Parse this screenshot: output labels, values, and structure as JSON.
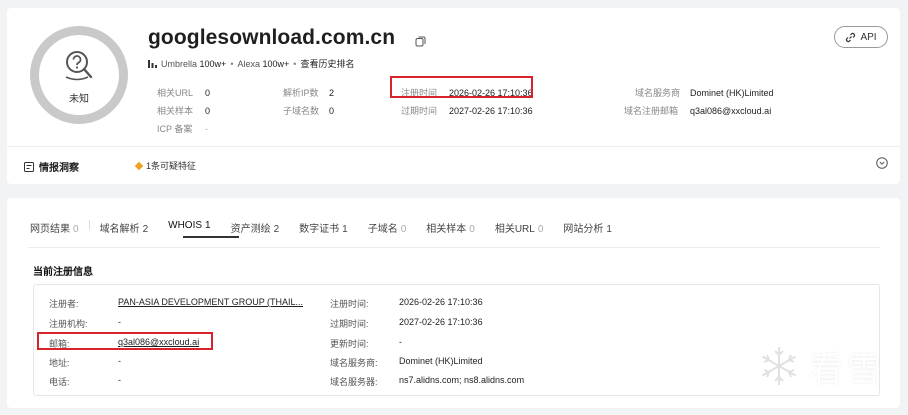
{
  "header": {
    "domain": "googlesownload.com.cn",
    "risk_label": "未知",
    "api_label": "API",
    "rank": {
      "umbrella_label": "Umbrella",
      "umbrella_value": "100w+",
      "alexa_label": "Alexa",
      "alexa_value": "100w+",
      "history_link": "查看历史排名"
    },
    "meta": {
      "related_url_label": "相关URL",
      "related_url_value": "0",
      "dns_ip_label": "解析IP数",
      "dns_ip_value": "2",
      "reg_time_label": "注册时间",
      "reg_time_value": "2026-02-26 17:10:36",
      "registrar_label": "域名服务商",
      "registrar_value": "Dominet (HK)Limited",
      "related_sample_label": "相关样本",
      "related_sample_value": "0",
      "subdomain_label": "子域名数",
      "subdomain_value": "0",
      "expire_label": "过期时间",
      "expire_value": "2027-02-26 17:10:36",
      "reg_email_label": "域名注册邮箱",
      "reg_email_value": "q3al086@xxcloud.ai",
      "icp_label": "ICP 备案",
      "icp_value": "-"
    },
    "intel": {
      "title": "情报洞察",
      "suspicious": "1条可疑特征"
    }
  },
  "tabs": [
    {
      "label": "网页结果",
      "count": "0"
    },
    {
      "label": "域名解析",
      "count": "2"
    },
    {
      "label": "WHOIS",
      "count": "1"
    },
    {
      "label": "资产测绘",
      "count": "2"
    },
    {
      "label": "数字证书",
      "count": "1"
    },
    {
      "label": "子域名",
      "count": "0"
    },
    {
      "label": "相关样本",
      "count": "0"
    },
    {
      "label": "相关URL",
      "count": "0"
    },
    {
      "label": "网站分析",
      "count": "1"
    }
  ],
  "whois": {
    "section_title": "当前注册信息",
    "left": [
      {
        "label": "注册者:",
        "value": "PAN-ASIA DEVELOPMENT GROUP (THAIL..."
      },
      {
        "label": "注册机构:",
        "value": "-"
      },
      {
        "label": "邮箱:",
        "value": "q3al086@xxcloud.ai"
      },
      {
        "label": "地址:",
        "value": "-"
      },
      {
        "label": "电话:",
        "value": "-"
      }
    ],
    "right": [
      {
        "label": "注册时间:",
        "value": "2026-02-26 17:10:36"
      },
      {
        "label": "过期时间:",
        "value": "2027-02-26 17:10:36"
      },
      {
        "label": "更新时间:",
        "value": "-"
      },
      {
        "label": "域名服务商:",
        "value": "Dominet (HK)Limited"
      },
      {
        "label": "域名服务器:",
        "value": "ns7.alidns.com; ns8.alidns.com"
      }
    ]
  },
  "watermark": "看雪",
  "colors": {
    "highlight": "#d9232b",
    "accent_diamond": "#f0a020",
    "risk_ring": "#c9c9c9"
  }
}
